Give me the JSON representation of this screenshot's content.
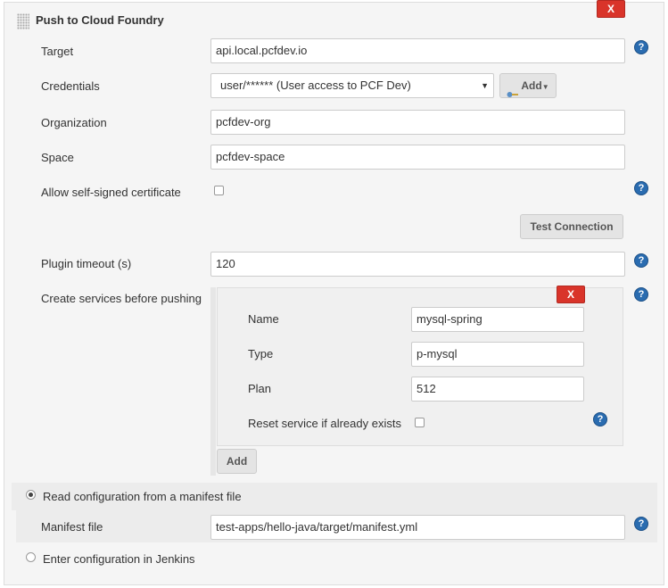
{
  "section": {
    "title": "Push to Cloud Foundry",
    "close_label": "X"
  },
  "fields": {
    "target": {
      "label": "Target",
      "value": "api.local.pcfdev.io"
    },
    "credentials": {
      "label": "Credentials",
      "selected": "user/****** (User access to PCF Dev)",
      "add_label": "Add"
    },
    "organization": {
      "label": "Organization",
      "value": "pcfdev-org"
    },
    "space": {
      "label": "Space",
      "value": "pcfdev-space"
    },
    "self_signed": {
      "label": "Allow self-signed certificate",
      "checked": false
    },
    "test_connection_label": "Test Connection",
    "plugin_timeout": {
      "label": "Plugin timeout (s)",
      "value": "120"
    },
    "create_services": {
      "label": "Create services before pushing"
    }
  },
  "service": {
    "close_label": "X",
    "name": {
      "label": "Name",
      "value": "mysql-spring"
    },
    "type": {
      "label": "Type",
      "value": "p-mysql"
    },
    "plan": {
      "label": "Plan",
      "value": "512"
    },
    "reset": {
      "label": "Reset service if already exists",
      "checked": false
    },
    "add_label": "Add"
  },
  "config": {
    "manifest_option": {
      "label": "Read configuration from a manifest file",
      "selected": true
    },
    "manifest_file": {
      "label": "Manifest file",
      "value": "test-apps/hello-java/target/manifest.yml"
    },
    "jenkins_option": {
      "label": "Enter configuration in Jenkins",
      "selected": false
    }
  },
  "help_icon": "?",
  "colors": {
    "delete": "#d9342a",
    "help": "#2a6cb0"
  }
}
